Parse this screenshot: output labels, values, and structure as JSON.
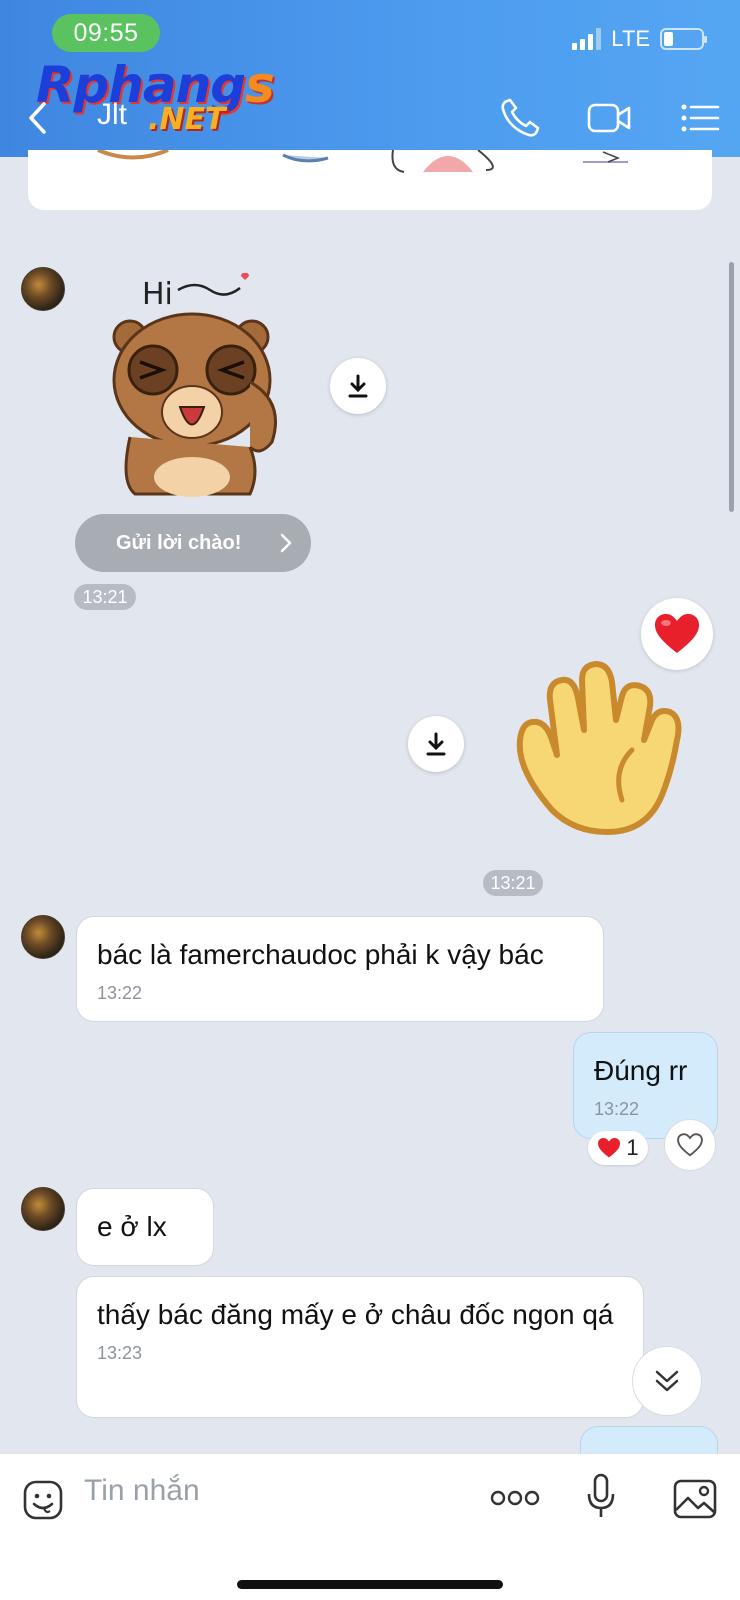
{
  "status_bar": {
    "time": "09:55",
    "network": "LTE"
  },
  "watermark": {
    "brand_text": "Rphang",
    "brand_s": "s",
    "suffix": ".NET"
  },
  "header": {
    "title": "Jlt",
    "icons": [
      "chevron-left-icon",
      "phone-icon",
      "video-icon",
      "list-menu-icon"
    ]
  },
  "messages": {
    "greeting_button": "Gửi lời chào!",
    "sticker_time": "13:21",
    "wave_time": "13:21",
    "m1": {
      "text": "bác là famerchaudoc phải k vậy bác",
      "time": "13:22"
    },
    "m2": {
      "text": "Đúng rr",
      "time": "13:22",
      "reaction_count": "1"
    },
    "m3": {
      "text": "e ở lx"
    },
    "m4": {
      "text": "thấy bác đăng mấy e ở châu đốc ngon qá",
      "time": "13:23"
    }
  },
  "input": {
    "placeholder": "Tin nhắn"
  },
  "colors": {
    "header": "#4a94ea",
    "time_pill": "#5bc260",
    "bubble_me": "#d3ebfb",
    "chat_bg": "#e2e7ef"
  }
}
